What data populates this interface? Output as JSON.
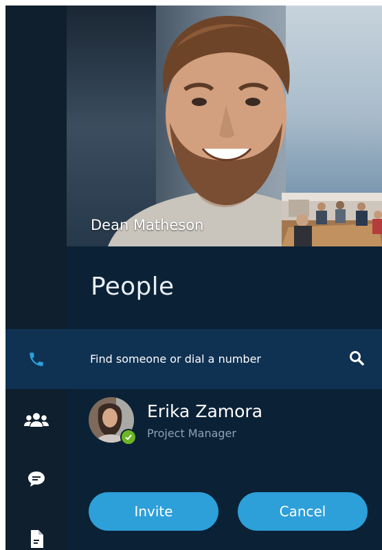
{
  "call": {
    "caller_name": "Dean Matheson"
  },
  "panel": {
    "title": "People"
  },
  "search": {
    "placeholder": "Find someone or dial a number"
  },
  "contact": {
    "name": "Erika Zamora",
    "title": "Project Manager",
    "presence": "available"
  },
  "actions": {
    "invite_label": "Invite",
    "cancel_label": "Cancel"
  },
  "rail": {
    "items": [
      "phone-icon",
      "people-icon",
      "chat-icon",
      "document-icon"
    ]
  },
  "colors": {
    "accent": "#2d9fd9",
    "panel_bg": "#0b2136",
    "rail_bg": "#0f1f2d",
    "active_row": "#0f3152",
    "presence_green": "#6cb524"
  }
}
